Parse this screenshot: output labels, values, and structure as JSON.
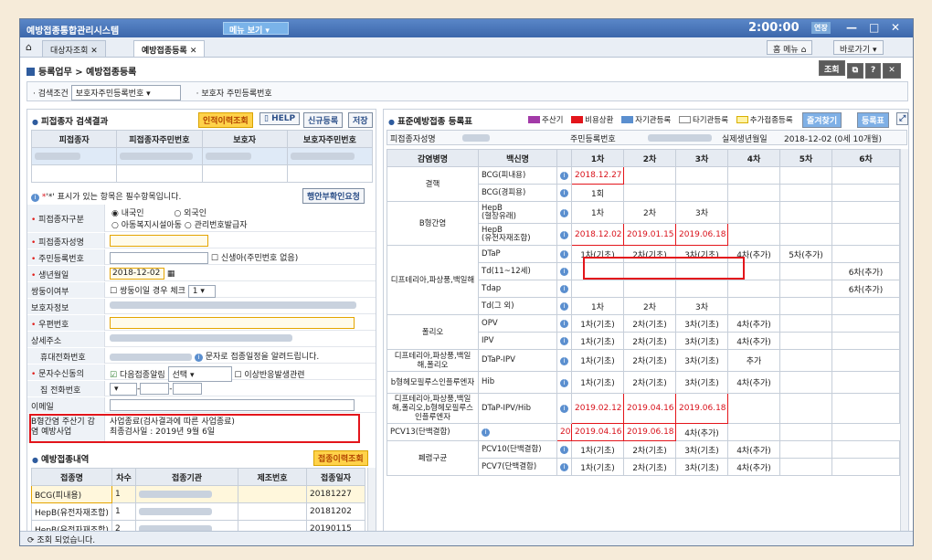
{
  "title": {
    "app": "예방접종통합관리시스템",
    "menu": "메뉴 보기",
    "clock": "2:00:00",
    "extend": "연장",
    "min": "—",
    "max": "□",
    "close": "✕"
  },
  "tabs": {
    "t1": "대상자조회",
    "t2": "예방접종등록",
    "menu": "홈 메뉴",
    "goto": "바로가기"
  },
  "crumb": "등록업무 > 예방접종등록",
  "topbtns": {
    "search": "조회"
  },
  "cond": {
    "label": "· 검색조건",
    "select": "보호자주민등록번호",
    "label2": "· 보호자 주민등록번호"
  },
  "left": {
    "search_title": "피접종자 검색결과",
    "btn_history": "인적이력조회",
    "btn_help": "HELP",
    "btn_new": "신규등록",
    "btn_save": "저장",
    "cols": [
      "피접종자",
      "피접종자주민번호",
      "보호자",
      "보호자주민번호"
    ],
    "required_note": "'*' 표시가 있는 항목은 필수항목입니다.",
    "btn_admin": "행안부확인요청",
    "type_label": "피접종자구분",
    "type_opts": [
      "내국인",
      "외국인",
      "아동복지시설아동",
      "관리번호발급자"
    ],
    "name_label": "피접종자성명",
    "rrn_label": "주민등록번호",
    "newborn": "신생아(주민번호 없음)",
    "birth_label": "생년월일",
    "birth": "2018-12-02",
    "twin_label": "쌍둥이여부",
    "twin_text": "쌍둥이일 경우 체크",
    "twin_sel": "1",
    "guardian_label": "보호자정보",
    "zip_label": "우편번호",
    "addr_label": "상세주소",
    "mobile_label": "휴대전화번호",
    "sms_note": "문자로 접종일정을 알려드립니다.",
    "sms_label": "문자수신동의",
    "sms_check": "다음접종알림",
    "sms_sel": "선택",
    "sms_check2": "이상반응발생관련",
    "home_label": "집 전화번호",
    "email_label": "이메일",
    "hepb_label": "B형간염 주산기 감염 예방사업",
    "hepb_val": "사업종료(검사결과에 따른 사업종료)",
    "hepb_val2": "최종검사일 : 2019년 9월 6일",
    "hist_title": "예방접종내역",
    "btn_hist": "접종이력조회",
    "hist_cols": [
      "접종명",
      "차수",
      "접종기관",
      "제조번호",
      "접종일자"
    ],
    "hist_rows": [
      [
        "BCG(피내용)",
        "1",
        "",
        "",
        "20181227"
      ],
      [
        "HepB(유전자재조합)",
        "1",
        "",
        "",
        "20181202"
      ],
      [
        "HepB(유전자재조합)",
        "2",
        "",
        "",
        "20190115"
      ]
    ]
  },
  "right": {
    "title": "표준예방접종 등록표",
    "legend": [
      "주산기",
      "비용상환",
      "자기관등록",
      "타기관등록",
      "추가접종등록"
    ],
    "btn_fav": "즐겨찾기",
    "btn_reg": "등록표",
    "name_label": "피접종자성명",
    "rrn_label": "주민등록번호",
    "birth_label": "실제생년월일",
    "birth_val": "2018-12-02 (0세 10개월)",
    "cols": [
      "감염병명",
      "백신명",
      "",
      "1차",
      "2차",
      "3차",
      "4차",
      "5차",
      "6차"
    ],
    "rows": [
      [
        "결핵",
        "BCG(피내용)",
        "2018.12.27",
        "",
        "",
        "",
        "",
        ""
      ],
      [
        "",
        "BCG(경피용)",
        "1회",
        "",
        "",
        "",
        "",
        ""
      ],
      [
        "B형간염",
        "HepB\n(혈장유래)",
        "1차",
        "2차",
        "3차",
        "",
        "",
        ""
      ],
      [
        "",
        "HepB\n(유전자재조합)",
        "2018.12.02",
        "2019.01.15",
        "2019.06.18",
        "",
        "",
        ""
      ],
      [
        "디프테리아,파상풍,백일해",
        "DTaP",
        "1차(기초)",
        "2차(기초)",
        "3차(기초)",
        "4차(추가)",
        "5차(추가)",
        ""
      ],
      [
        "",
        "Td(11~12세)",
        "",
        "",
        "",
        "",
        "",
        "6차(추가)"
      ],
      [
        "",
        "Tdap",
        "",
        "",
        "",
        "",
        "",
        "6차(추가)"
      ],
      [
        "",
        "Td(그 외)",
        "1차",
        "2차",
        "3차",
        "",
        "",
        ""
      ],
      [
        "폴리오",
        "OPV",
        "1차(기초)",
        "2차(기초)",
        "3차(기초)",
        "4차(추가)",
        "",
        ""
      ],
      [
        "",
        "IPV",
        "1차(기초)",
        "2차(기초)",
        "3차(기초)",
        "4차(추가)",
        "",
        ""
      ],
      [
        "디프테리아,파상풍,백일해,폴리오",
        "DTaP-IPV",
        "1차(기초)",
        "2차(기초)",
        "3차(기초)",
        "추가",
        "",
        ""
      ],
      [
        "b형헤모필루스인플루엔자",
        "Hib",
        "1차(기초)",
        "2차(기초)",
        "3차(기초)",
        "4차(추가)",
        "",
        ""
      ],
      [
        "디프테리아,파상풍,백일해,폴리오,b형헤모필루스인플루엔자",
        "DTaP-IPV/Hib",
        "2019.02.12",
        "2019.04.16",
        "2019.06.18",
        "",
        "",
        ""
      ],
      [
        "",
        "PCV13(단백결합)",
        "2019.02.12",
        "2019.04.16",
        "2019.06.18",
        "4차(추가)",
        "",
        ""
      ],
      [
        "폐렴구균",
        "PCV10(단백결합)",
        "1차(기초)",
        "2차(기초)",
        "3차(기초)",
        "4차(추가)",
        "",
        ""
      ],
      [
        "",
        "PCV7(단백결합)",
        "1차(기초)",
        "2차(기초)",
        "3차(기초)",
        "4차(추가)",
        "",
        ""
      ]
    ]
  },
  "status": "조회 되었습니다.",
  "colors": {
    "title": "#3c67ab",
    "accent": "#ffd24a",
    "red": "#e3151b",
    "legend": [
      "#a23aa8",
      "#e3151b",
      "#5b8fcf",
      "#ffffff",
      "#fff3a6"
    ]
  }
}
